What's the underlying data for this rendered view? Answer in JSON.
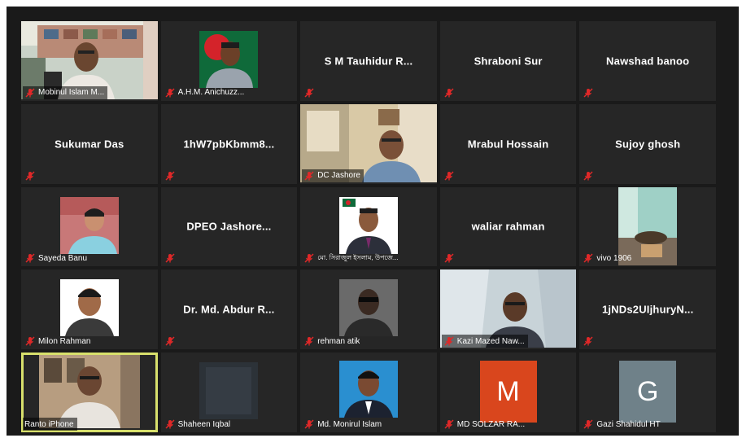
{
  "participants": [
    {
      "name": "Mobinul Islam M...",
      "type": "video"
    },
    {
      "name": "A.H.M. Anichuzz...",
      "type": "photo"
    },
    {
      "name": "S M Tauhidur R...",
      "type": "name"
    },
    {
      "name": "Shraboni Sur",
      "type": "name"
    },
    {
      "name": "Nawshad banoo",
      "type": "name"
    },
    {
      "name": "Sukumar Das",
      "type": "name"
    },
    {
      "name": "1hW7pbKbmm8...",
      "type": "name"
    },
    {
      "name": "DC Jashore",
      "type": "video"
    },
    {
      "name": "Mrabul Hossain",
      "type": "name"
    },
    {
      "name": "Sujoy ghosh",
      "type": "name"
    },
    {
      "name": "Sayeda Banu",
      "type": "photo"
    },
    {
      "name": "DPEO Jashore...",
      "type": "name"
    },
    {
      "name": "মো. সিরাজুল ইসলাম, উপজে...",
      "type": "photo"
    },
    {
      "name": "waliar rahman",
      "type": "name"
    },
    {
      "name": "vivo 1906",
      "type": "video"
    },
    {
      "name": "Milon Rahman",
      "type": "photo"
    },
    {
      "name": "Dr. Md. Abdur R...",
      "type": "name"
    },
    {
      "name": "rehman atik",
      "type": "photo"
    },
    {
      "name": "Kazi Mazed Naw...",
      "type": "video"
    },
    {
      "name": "1jNDs2UIjhuryN...",
      "type": "name"
    },
    {
      "name": "Ranto iPhone",
      "type": "video"
    },
    {
      "name": "Shaheen Iqbal",
      "type": "photo"
    },
    {
      "name": "Md. Monirul Islam",
      "type": "photo"
    },
    {
      "name": "MD SOLZAR RA...",
      "type": "letter",
      "letter": "M",
      "color": "#d9461d"
    },
    {
      "name": "Gazi Shahidul HT",
      "type": "letter",
      "letter": "G",
      "color": "#6f8189"
    }
  ],
  "colors": {
    "background": "#1a1a1a",
    "tile": "#262626",
    "active_speaker": "#d8e06c",
    "muted_mic": "#e02828"
  },
  "icons": {
    "muted": "mic-muted-icon"
  }
}
